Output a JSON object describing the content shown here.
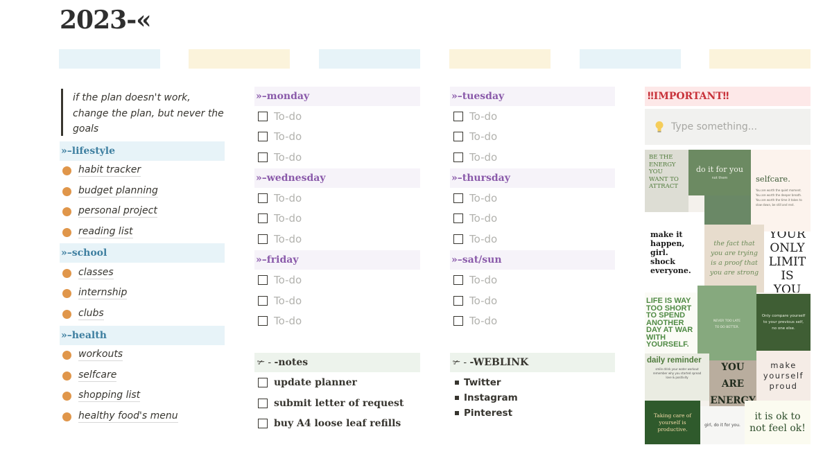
{
  "page": {
    "title": "2023-«"
  },
  "color_strips": [
    "#e7f3f8",
    "#fbf3db",
    "#e7f3f8",
    "#fbf3db",
    "#e7f3f8",
    "#fbf3db"
  ],
  "quote": "if the plan doesn't work, change the plan, but never the goals",
  "left": {
    "sections": [
      {
        "title": "»–lifestyle",
        "items": [
          "habit tracker",
          "budget planning",
          "personal project",
          "reading list"
        ]
      },
      {
        "title": "»–school",
        "items": [
          "classes",
          "internship",
          "clubs"
        ]
      },
      {
        "title": "»–health",
        "items": [
          "workouts",
          "selfcare",
          "shopping list",
          "healthy food's menu"
        ]
      }
    ]
  },
  "days": [
    {
      "title": "»–monday",
      "todos": [
        "To-do",
        "To-do",
        "To-do"
      ]
    },
    {
      "title": "»–tuesday",
      "todos": [
        "To-do",
        "To-do",
        "To-do"
      ]
    },
    {
      "title": "»–wednesday",
      "todos": [
        "To-do",
        "To-do",
        "To-do"
      ]
    },
    {
      "title": "»–thursday",
      "todos": [
        "To-do",
        "To-do",
        "To-do"
      ]
    },
    {
      "title": "»–friday",
      "todos": [
        "To-do",
        "To-do",
        "To-do"
      ]
    },
    {
      "title": "»–sat/sun",
      "todos": [
        "To-do",
        "To-do",
        "To-do"
      ]
    }
  ],
  "notes": {
    "title": "-notes",
    "icon": "scissors-icon",
    "items": [
      "update planner",
      "submit letter of request",
      "buy A4 loose leaf refills"
    ]
  },
  "weblink": {
    "title": "-WEBLINK",
    "icon": "scissors-icon",
    "items": [
      "Twitter",
      "Instagram",
      "Pinterest"
    ]
  },
  "important": {
    "title": "IMPORTANT",
    "marks": "‼",
    "input_placeholder": "Type something...",
    "input_icon": "lightbulb-icon"
  },
  "collage": {
    "tiles": [
      {
        "text": "BE THE ENERGY YOU WANT TO ATTRACT"
      },
      {
        "text": "do it for you",
        "sub": "not them"
      },
      {
        "text": "selfcare.",
        "sub": "You are worth the quiet moment. You are worth the deeper breath. You are worth the time it takes to slow down, be still and rest."
      },
      {
        "text": "make it happen, girl. shock everyone."
      },
      {
        "text": "the fact that you are trying is a proof that you are strong"
      },
      {
        "text": "YOUR ONLY LIMIT IS YOU"
      },
      {
        "text": "LIFE IS WAY TOO SHORT TO SPEND ANOTHER DAY AT WAR WITH YOURSELF."
      },
      {
        "text": "NEVER TOO LATE TO DO BETTER."
      },
      {
        "text": "Only compare yourself to your previous self, no one else."
      },
      {
        "text": "daily reminder",
        "sub": "smile drink your water workout remember why you started spread love & positivity"
      },
      {
        "text": "YOU ARE ENERGY"
      },
      {
        "text": "make yourself proud"
      },
      {
        "text": "Taking care of yourself is productive."
      },
      {
        "text": "girl, do it for you."
      },
      {
        "text": "it is ok to not feel ok!"
      }
    ]
  }
}
